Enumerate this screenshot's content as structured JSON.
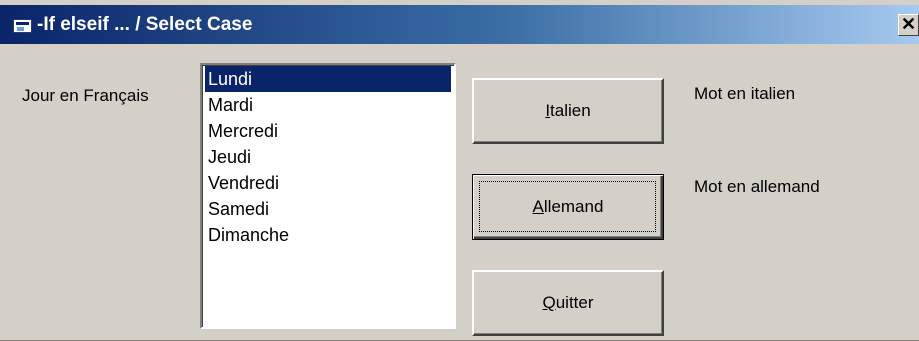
{
  "window": {
    "title": "-If elseif ... / Select Case",
    "close_glyph": "✕"
  },
  "labels": {
    "jour": "Jour en Français",
    "mot_italien": "Mot en italien",
    "mot_allemand": "Mot en allemand"
  },
  "listbox": {
    "selected_index": 0,
    "items": [
      "Lundi",
      "Mardi",
      "Mercredi",
      "Jeudi",
      "Vendredi",
      "Samedi",
      "Dimanche"
    ]
  },
  "buttons": {
    "italien": {
      "mnemonic": "I",
      "rest": "talien"
    },
    "allemand": {
      "mnemonic": "A",
      "rest": "llemand"
    },
    "quitter": {
      "mnemonic": "Q",
      "rest": "uitter"
    }
  },
  "colors": {
    "title_gradient_start": "#0a246a",
    "title_gradient_end": "#a6caf0",
    "selection": "#0a246a",
    "face": "#d4d0c8"
  },
  "icons": {
    "window_icon": "form-window-icon",
    "close_icon": "close-icon"
  }
}
